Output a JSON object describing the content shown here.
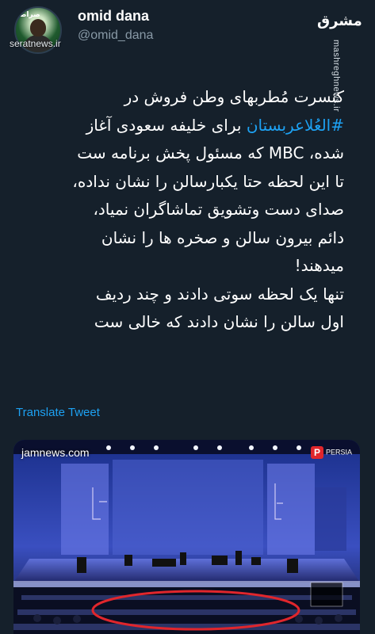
{
  "header": {
    "display_name": "omid dana",
    "handle": "@omid_dana",
    "avatar_watermark": "seratnews.ir",
    "source_logo": "مشرق",
    "source_vertical": "mashreghnews.ir"
  },
  "tweet": {
    "lines": [
      "کنسرت مُطربهای وطن فروش در",
      "برای خلیفه سعودی آغاز",
      "شده، MBC که مسئول پخش برنامه ست",
      "تا این لحظه حتا یکبارسالن را نشان نداده،",
      "صدای دست وتشویق تماشاگران نمیاد،",
      "دائم بیرون سالن و صخره ها را نشان",
      "میدهند!",
      "تنها یک لحظه سوتی دادند و چند ردیف",
      "اول سالن را نشان دادند که خالی ست"
    ],
    "hashtag": "#العُلاعربستان",
    "translate_label": "Translate Tweet"
  },
  "media": {
    "watermark_left": "jamnews.com",
    "watermark_right": "PERSIA",
    "circle_color": "#e0262c"
  },
  "colors": {
    "background": "#15202b",
    "text": "#ffffff",
    "muted": "#8899a6",
    "link": "#1da1f2"
  }
}
